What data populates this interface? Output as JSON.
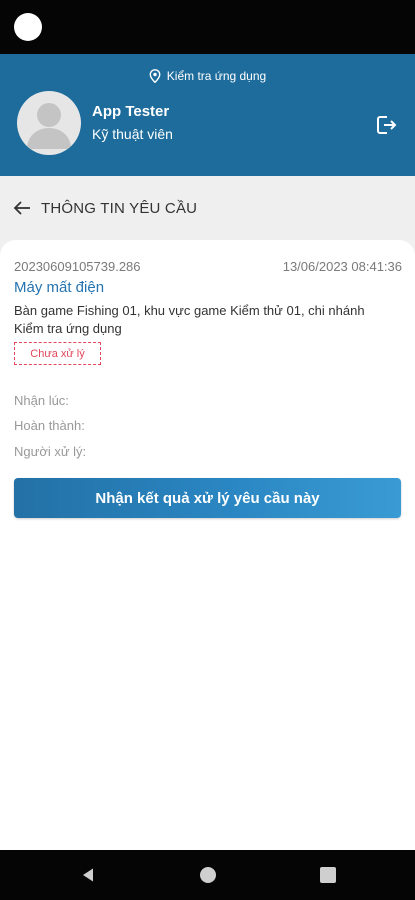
{
  "header": {
    "location": "Kiểm tra ứng dụng",
    "user_name": "App Tester",
    "user_role": "Kỹ thuật viên"
  },
  "page": {
    "title": "THÔNG TIN YÊU CẦU"
  },
  "request": {
    "id": "20230609105739.286",
    "datetime": "13/06/2023 08:41:36",
    "title": "Máy mất điện",
    "description": "Bàn game Fishing 01, khu vực game Kiểm thử 01, chi nhánh Kiểm tra ứng dụng",
    "status": "Chưa xử lý",
    "fields": {
      "received_at_label": "Nhận lúc:",
      "completed_label": "Hoàn thành:",
      "handler_label": "Người xử lý:"
    }
  },
  "actions": {
    "accept_label": "Nhận kết quả xử lý yêu cầu này"
  },
  "colors": {
    "header_bg": "#1d6c9c",
    "accent": "#2474b0",
    "status_red": "#e0475a"
  },
  "icons": {
    "location": "location-pin-icon",
    "logout": "logout-icon",
    "back": "arrow-left-icon",
    "avatar": "user-placeholder-icon"
  }
}
